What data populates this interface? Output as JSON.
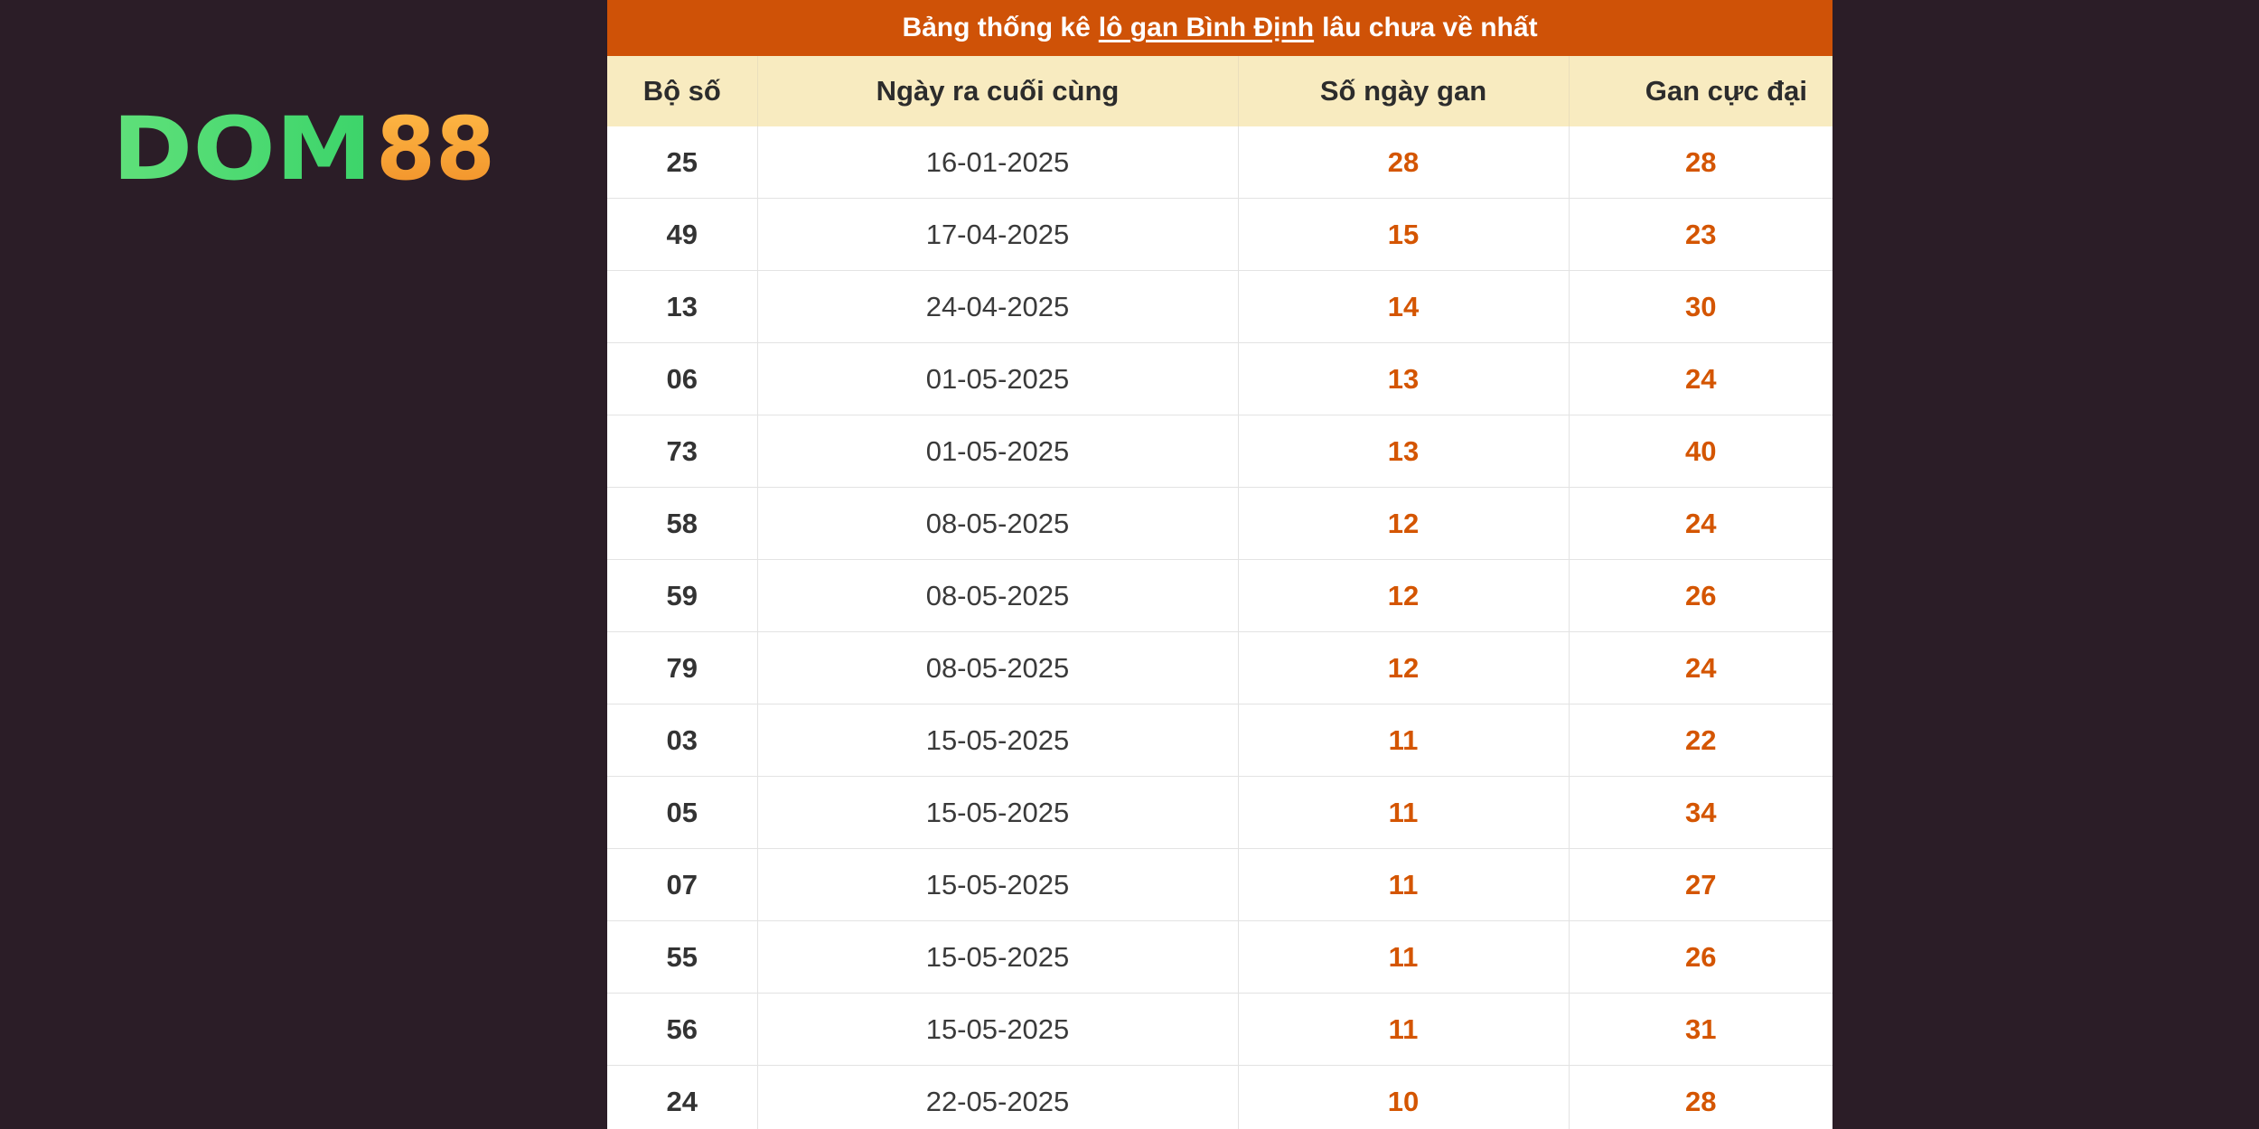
{
  "brand": {
    "logo_main": "DOM",
    "logo_accent": "88",
    "main_color": "#5fe27a",
    "accent_color": "#f7a536"
  },
  "title": {
    "prefix": "Bảng thống kê",
    "link": "lô gan Bình Định",
    "suffix": "lâu chưa về nhất"
  },
  "table": {
    "headers": [
      "Bộ số",
      "Ngày ra cuối cùng",
      "Số ngày gan",
      "Gan cực đại"
    ],
    "rows": [
      [
        "25",
        "16-01-2025",
        "28",
        "28"
      ],
      [
        "49",
        "17-04-2025",
        "15",
        "23"
      ],
      [
        "13",
        "24-04-2025",
        "14",
        "30"
      ],
      [
        "06",
        "01-05-2025",
        "13",
        "24"
      ],
      [
        "73",
        "01-05-2025",
        "13",
        "40"
      ],
      [
        "58",
        "08-05-2025",
        "12",
        "24"
      ],
      [
        "59",
        "08-05-2025",
        "12",
        "26"
      ],
      [
        "79",
        "08-05-2025",
        "12",
        "24"
      ],
      [
        "03",
        "15-05-2025",
        "11",
        "22"
      ],
      [
        "05",
        "15-05-2025",
        "11",
        "34"
      ],
      [
        "07",
        "15-05-2025",
        "11",
        "27"
      ],
      [
        "55",
        "15-05-2025",
        "11",
        "26"
      ],
      [
        "56",
        "15-05-2025",
        "11",
        "31"
      ],
      [
        "24",
        "22-05-2025",
        "10",
        "28"
      ]
    ]
  },
  "colors": {
    "background": "#2b1d27",
    "title_bar": "#cf5207",
    "header_bg": "#f8ebc0",
    "highlight_number": "#d45500"
  }
}
